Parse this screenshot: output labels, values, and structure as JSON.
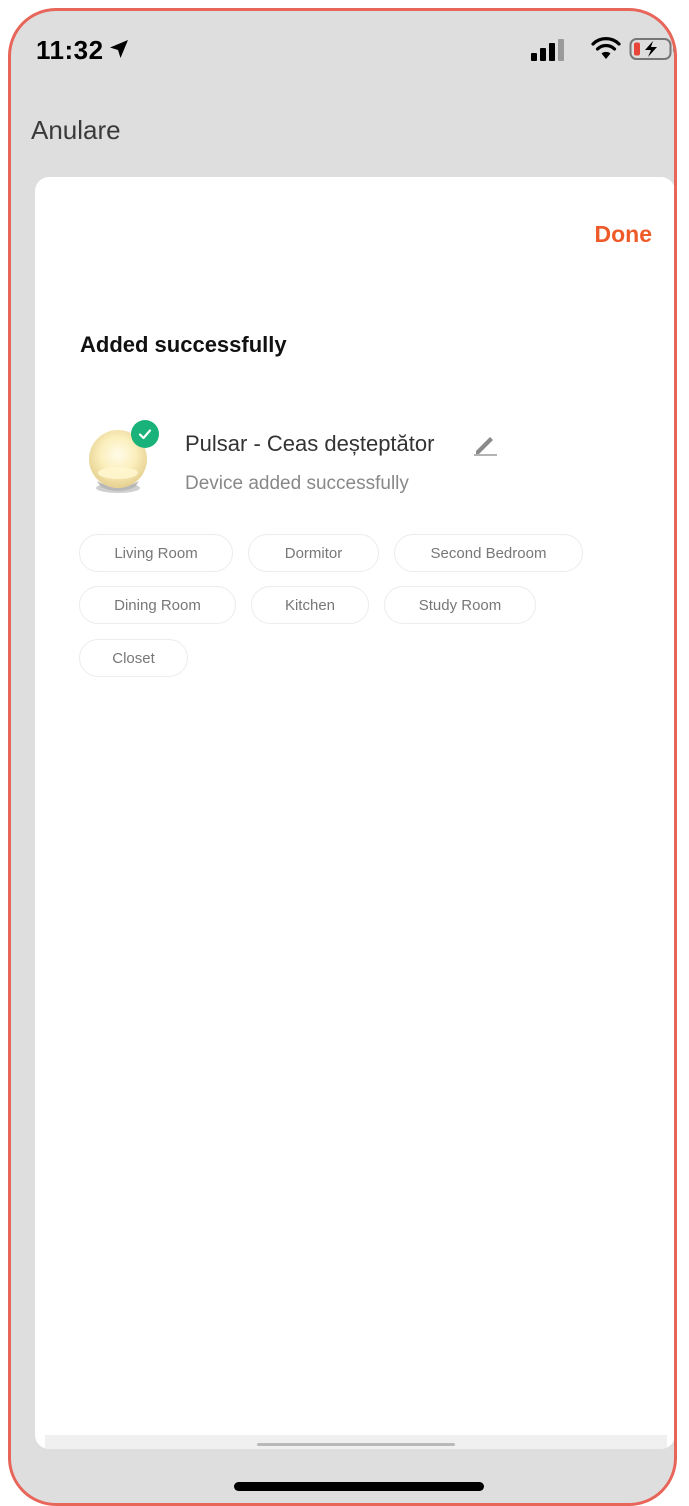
{
  "status_bar": {
    "time": "11:32"
  },
  "nav": {
    "cancel_label": "Anulare"
  },
  "sheet": {
    "done_label": "Done",
    "heading": "Added successfully",
    "device": {
      "name": "Pulsar - Ceas deșteptător",
      "status": "Device added successfully"
    },
    "rooms": [
      "Living Room",
      "Dormitor",
      "Second Bedroom",
      "Dining Room",
      "Kitchen",
      "Study Room",
      "Closet"
    ]
  },
  "colors": {
    "accent": "#ee5b29",
    "success": "#19b27a",
    "frame": "#e8655a"
  },
  "icons": {
    "location": "location-arrow-icon",
    "signal": "cellular-signal-icon",
    "wifi": "wifi-icon",
    "battery": "battery-charging-icon",
    "check": "check-badge-icon",
    "edit": "pencil-icon"
  }
}
